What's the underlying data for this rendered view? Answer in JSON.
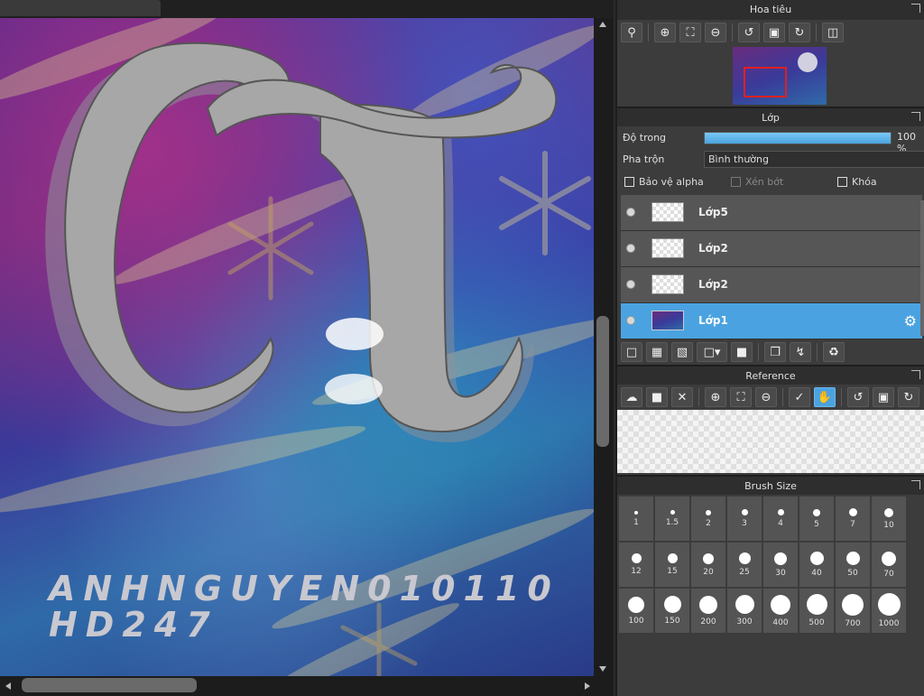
{
  "canvas": {
    "signature_line1": "ANHNGUYEN010110",
    "signature_line2": "HD247"
  },
  "navigator": {
    "title": "Hoa tiêu",
    "tools": [
      "zoom-reset-icon",
      "zoom-in-icon",
      "fit-icon",
      "zoom-out-icon",
      "rotate-left-icon",
      "fit-screen-icon",
      "rotate-right-icon",
      "flip-icon"
    ]
  },
  "layers": {
    "title": "Lớp",
    "opacity_label": "Độ trong",
    "opacity_value": "100 %",
    "opacity_fraction": 1.0,
    "blend_label": "Pha trộn",
    "blend_value": "Bình thường",
    "protect_alpha": "Bảo vệ alpha",
    "clipping": "Xén bớt",
    "lock": "Khóa",
    "items": [
      {
        "name": "Lớp5",
        "selected": false
      },
      {
        "name": "Lớp2",
        "selected": false
      },
      {
        "name": "Lớp2",
        "selected": false
      },
      {
        "name": "Lớp1",
        "selected": true
      }
    ]
  },
  "reference": {
    "title": "Reference"
  },
  "brush_size": {
    "title": "Brush Size",
    "sizes": [
      "1",
      "1.5",
      "2",
      "3",
      "4",
      "5",
      "7",
      "10",
      "12",
      "15",
      "20",
      "25",
      "30",
      "40",
      "50",
      "70",
      "100",
      "150",
      "200",
      "300",
      "400",
      "500",
      "700",
      "1000"
    ]
  },
  "colors": {
    "accent": "#4aa3e0",
    "panel_bg": "#3c3c3c",
    "title_bg": "#2e2e2e",
    "nav_rect": "#e02020"
  }
}
